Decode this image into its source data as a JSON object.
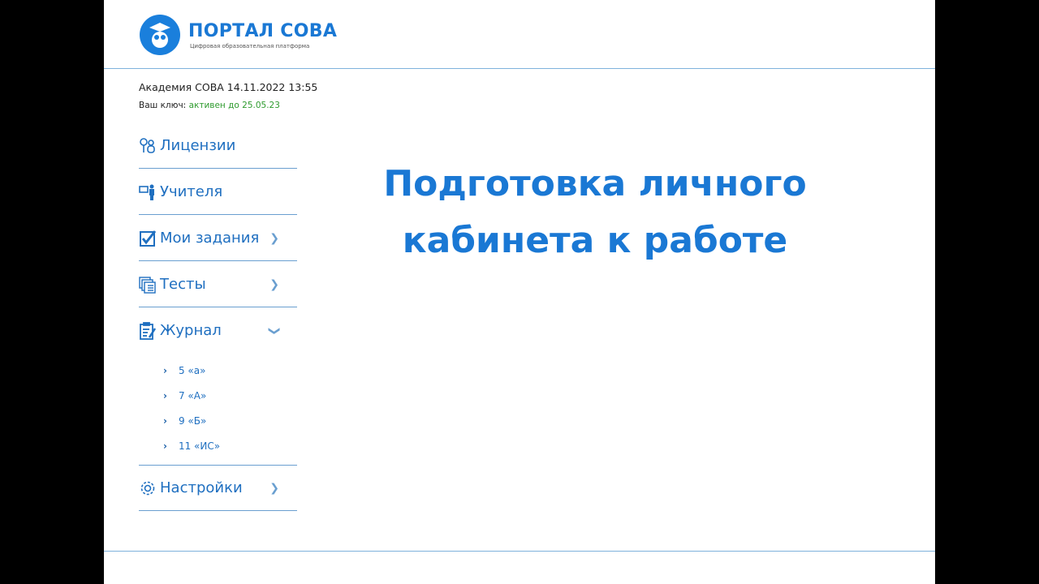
{
  "logo": {
    "title": "ПОРТАЛ СОВА",
    "subtitle": "Цифровая образовательная платформа"
  },
  "info": {
    "academy": "Академия СОВА 14.11.2022 13:55",
    "key_label": "Ваш ключ: ",
    "key_status": "активен до 25.05.23"
  },
  "menu": [
    {
      "label": "Лицензии"
    },
    {
      "label": "Учителя"
    },
    {
      "label": "Мои задания"
    },
    {
      "label": "Тесты"
    },
    {
      "label": "Журнал"
    },
    {
      "label": "Настройки"
    }
  ],
  "journal_classes": [
    "5 «а»",
    "7 «А»",
    "9 «Б»",
    "11 «ИС»"
  ],
  "headline": {
    "line1": "Подготовка личного",
    "line2": "кабинета к работе"
  },
  "colors": {
    "accent": "#1a78d4",
    "active": "#2e9b2e"
  }
}
